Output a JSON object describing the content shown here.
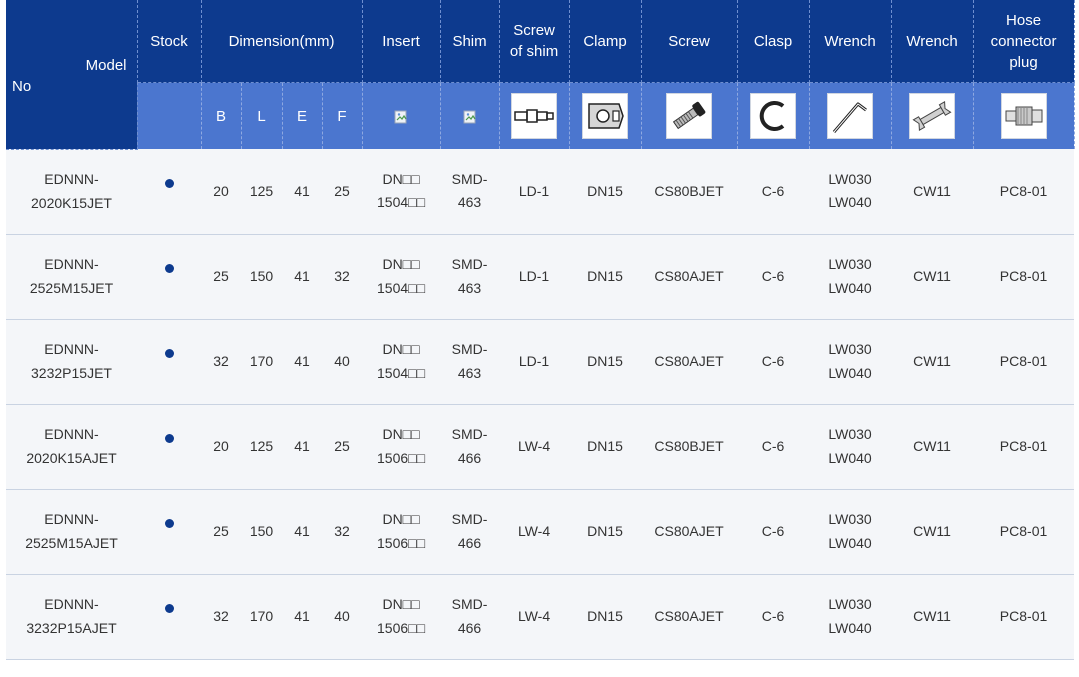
{
  "header": {
    "no": "No",
    "model": "Model",
    "stock": "Stock",
    "dimension": "Dimension(mm)",
    "insert": "Insert",
    "shim": "Shim",
    "screw_of_shim_1": "Screw",
    "screw_of_shim_2": "of shim",
    "clamp": "Clamp",
    "screw": "Screw",
    "clasp": "Clasp",
    "wrench_1": "Wrench",
    "wrench_2": "Wrench",
    "hose_1": "Hose",
    "hose_2": "connector",
    "hose_3": "plug",
    "dims": [
      "B",
      "L",
      "E",
      "F"
    ]
  },
  "icons": {
    "insert": "broken-image-icon",
    "shim": "broken-image-icon",
    "screw_of_shim": "shim-screw-icon",
    "clamp": "clamp-icon",
    "screw": "screw-icon",
    "clasp": "clasp-icon",
    "wrench1": "hex-key-icon",
    "wrench2": "open-wrench-icon",
    "hose": "hose-plug-icon"
  },
  "colors": {
    "header_dark": "#0d3a8e",
    "header_light": "#4b76cf",
    "stock_dot": "#0d3a8e"
  },
  "rows": [
    {
      "model1": "EDNNN-",
      "model2": "2020K15JET",
      "B": "20",
      "L": "125",
      "E": "41",
      "F": "25",
      "insert1": "DN□□",
      "insert2": "1504□□",
      "shim1": "SMD-",
      "shim2": "463",
      "screw_of_shim": "LD-1",
      "clamp": "DN15",
      "screw": "CS80BJET",
      "clasp": "C-6",
      "wrench1a": "LW030",
      "wrench1b": "LW040",
      "wrench2": "CW11",
      "hose": "PC8-01"
    },
    {
      "model1": "EDNNN-",
      "model2": "2525M15JET",
      "B": "25",
      "L": "150",
      "E": "41",
      "F": "32",
      "insert1": "DN□□",
      "insert2": "1504□□",
      "shim1": "SMD-",
      "shim2": "463",
      "screw_of_shim": "LD-1",
      "clamp": "DN15",
      "screw": "CS80AJET",
      "clasp": "C-6",
      "wrench1a": "LW030",
      "wrench1b": "LW040",
      "wrench2": "CW11",
      "hose": "PC8-01"
    },
    {
      "model1": "EDNNN-",
      "model2": "3232P15JET",
      "B": "32",
      "L": "170",
      "E": "41",
      "F": "40",
      "insert1": "DN□□",
      "insert2": "1504□□",
      "shim1": "SMD-",
      "shim2": "463",
      "screw_of_shim": "LD-1",
      "clamp": "DN15",
      "screw": "CS80AJET",
      "clasp": "C-6",
      "wrench1a": "LW030",
      "wrench1b": "LW040",
      "wrench2": "CW11",
      "hose": "PC8-01"
    },
    {
      "model1": "EDNNN-",
      "model2": "2020K15AJET",
      "B": "20",
      "L": "125",
      "E": "41",
      "F": "25",
      "insert1": "DN□□",
      "insert2": "1506□□",
      "shim1": "SMD-",
      "shim2": "466",
      "screw_of_shim": "LW-4",
      "clamp": "DN15",
      "screw": "CS80BJET",
      "clasp": "C-6",
      "wrench1a": "LW030",
      "wrench1b": "LW040",
      "wrench2": "CW11",
      "hose": "PC8-01"
    },
    {
      "model1": "EDNNN-",
      "model2": "2525M15AJET",
      "B": "25",
      "L": "150",
      "E": "41",
      "F": "32",
      "insert1": "DN□□",
      "insert2": "1506□□",
      "shim1": "SMD-",
      "shim2": "466",
      "screw_of_shim": "LW-4",
      "clamp": "DN15",
      "screw": "CS80AJET",
      "clasp": "C-6",
      "wrench1a": "LW030",
      "wrench1b": "LW040",
      "wrench2": "CW11",
      "hose": "PC8-01"
    },
    {
      "model1": "EDNNN-",
      "model2": "3232P15AJET",
      "B": "32",
      "L": "170",
      "E": "41",
      "F": "40",
      "insert1": "DN□□",
      "insert2": "1506□□",
      "shim1": "SMD-",
      "shim2": "466",
      "screw_of_shim": "LW-4",
      "clamp": "DN15",
      "screw": "CS80AJET",
      "clasp": "C-6",
      "wrench1a": "LW030",
      "wrench1b": "LW040",
      "wrench2": "CW11",
      "hose": "PC8-01"
    }
  ]
}
